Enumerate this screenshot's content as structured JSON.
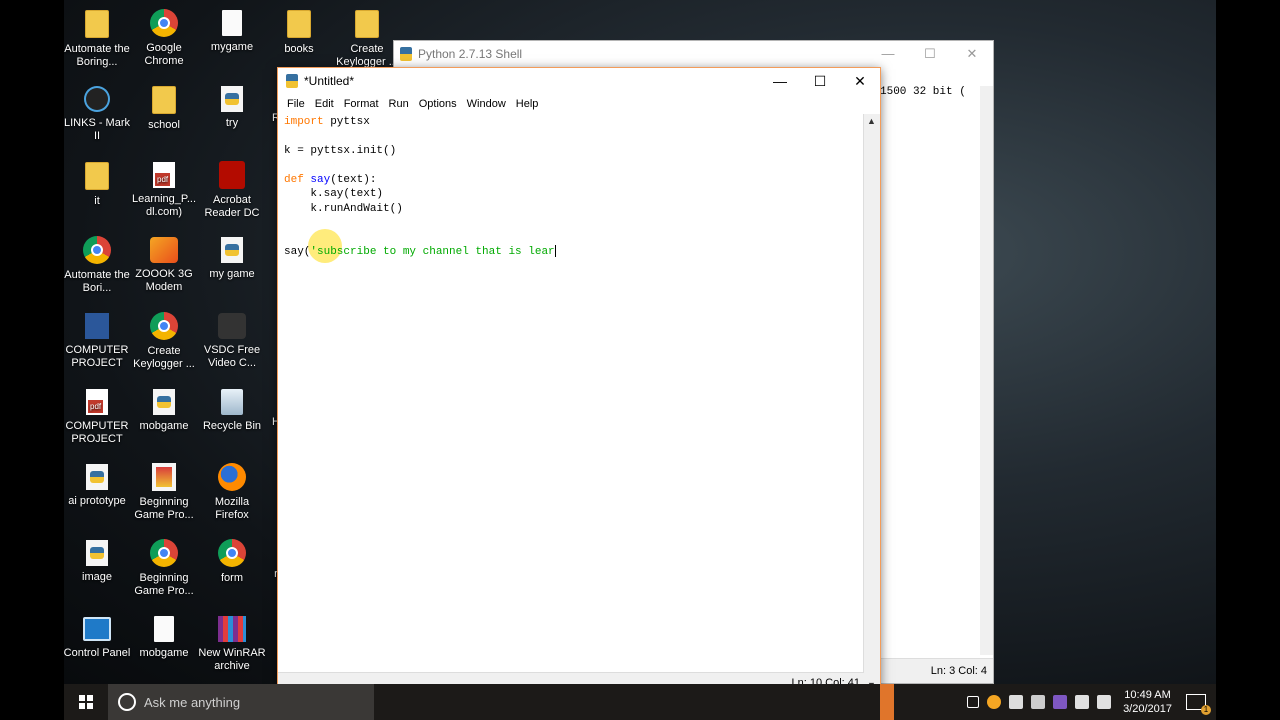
{
  "desktop_icons": [
    {
      "label": "Automate the Boring...",
      "icon": "folder-icon"
    },
    {
      "label": "Google Chrome",
      "icon": "chrome-icon"
    },
    {
      "label": "mygame",
      "icon": "file-icon"
    },
    {
      "label": "books",
      "icon": "folder-icon"
    },
    {
      "label": "Create Keylogger ...",
      "icon": "folder-icon"
    },
    {
      "label": "LINKS - Mark II",
      "icon": "app-icon"
    },
    {
      "label": "school",
      "icon": "folder-icon"
    },
    {
      "label": "try",
      "icon": "python-file-icon"
    },
    {
      "label": "it",
      "icon": "folder-icon"
    },
    {
      "label": "Learning_P... dl.com)",
      "icon": "pdf-icon"
    },
    {
      "label": "Acrobat Reader DC",
      "icon": "acrobat-icon"
    },
    {
      "label": "Automate the Bori...",
      "icon": "chrome-icon"
    },
    {
      "label": "ZOOOK 3G Modem",
      "icon": "modem-icon"
    },
    {
      "label": "my game",
      "icon": "python-file-icon"
    },
    {
      "label": "COMPUTER PROJECT",
      "icon": "word-icon"
    },
    {
      "label": "Create Keylogger ...",
      "icon": "chrome-icon"
    },
    {
      "label": "VSDC Free Video C...",
      "icon": "video-icon"
    },
    {
      "label": "COMPUTER PROJECT",
      "icon": "pdf-icon"
    },
    {
      "label": "mobgame",
      "icon": "python-file-icon"
    },
    {
      "label": "Recycle Bin",
      "icon": "recycle-bin-icon"
    },
    {
      "label": "ai prototype",
      "icon": "python-file-icon"
    },
    {
      "label": "Beginning Game Pro...",
      "icon": "book-icon"
    },
    {
      "label": "Mozilla Firefox",
      "icon": "firefox-icon"
    },
    {
      "label": "image",
      "icon": "python-file-icon"
    },
    {
      "label": "Beginning Game Pro...",
      "icon": "chrome-icon"
    },
    {
      "label": "form",
      "icon": "chrome-icon"
    },
    {
      "label": "Control Panel",
      "icon": "control-panel-icon"
    },
    {
      "label": "mobgame",
      "icon": "file-icon"
    },
    {
      "label": "New WinRAR archive",
      "icon": "winrar-icon"
    }
  ],
  "partial_icon_labels": [
    "R",
    "H",
    "r"
  ],
  "shell_window": {
    "title": "Python 2.7.13 Shell",
    "visible_text": "1500 32 bit (",
    "status": "Ln: 3   Col: 4"
  },
  "editor_window": {
    "title": "*Untitled*",
    "menu": [
      "File",
      "Edit",
      "Format",
      "Run",
      "Options",
      "Window",
      "Help"
    ],
    "status": "Ln: 10   Col: 41"
  },
  "code": {
    "l1_kw": "import",
    "l1_rest": " pyttsx",
    "l3": "k = pyttsx.init()",
    "l5_kw": "def",
    "l5_sp": " ",
    "l5_fn": "say",
    "l5_rest": "(text):",
    "l6": "    k.say(text)",
    "l7": "    k.runAndWait()",
    "l10_plain": "say(",
    "l10_str": "'subscribe to my channel that is lear"
  },
  "taskbar": {
    "search_placeholder": "Ask me anything",
    "time": "10:49 AM",
    "date": "3/20/2017"
  },
  "colors": {
    "keyword": "#ff7700",
    "definition": "#0000ff",
    "string": "#00aa00",
    "taskbar": "#1c1a18"
  }
}
